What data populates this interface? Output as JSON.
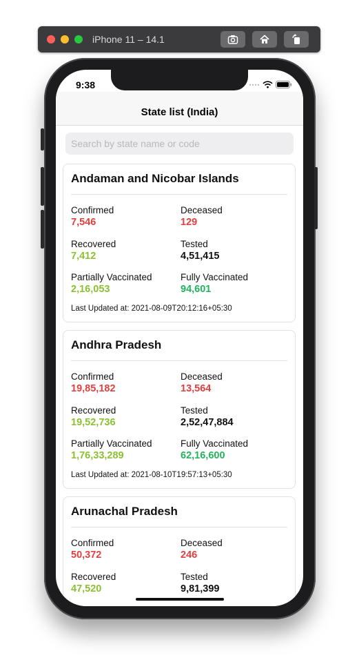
{
  "simulator": {
    "title": "iPhone 11 – 14.1",
    "buttons": [
      "screenshot-icon",
      "home-icon",
      "rotate-icon"
    ]
  },
  "status_bar": {
    "time": "9:38"
  },
  "nav": {
    "title": "State list (India)"
  },
  "search": {
    "placeholder": "Search by state name or code",
    "value": ""
  },
  "colors": {
    "confirmed": "#e0403f",
    "recovered": "#8ac131",
    "vaccinated_full": "#21b45b"
  },
  "labels": {
    "confirmed": "Confirmed",
    "deceased": "Deceased",
    "recovered": "Recovered",
    "tested": "Tested",
    "partially_vaccinated": "Partially Vaccinated",
    "fully_vaccinated": "Fully Vaccinated"
  },
  "states": [
    {
      "name": "Andaman and Nicobar Islands",
      "confirmed": "7,546",
      "deceased": "129",
      "recovered": "7,412",
      "tested": "4,51,415",
      "partially_vaccinated": "2,16,053",
      "fully_vaccinated": "94,601",
      "last_updated": "Last Updated at: 2021-08-09T20:12:16+05:30"
    },
    {
      "name": "Andhra Pradesh",
      "confirmed": "19,85,182",
      "deceased": "13,564",
      "recovered": "19,52,736",
      "tested": "2,52,47,884",
      "partially_vaccinated": "1,76,33,289",
      "fully_vaccinated": "62,16,600",
      "last_updated": "Last Updated at: 2021-08-10T19:57:13+05:30"
    },
    {
      "name": "Arunachal Pradesh",
      "confirmed": "50,372",
      "deceased": "246",
      "recovered": "47,520",
      "tested": "9,81,399"
    }
  ]
}
